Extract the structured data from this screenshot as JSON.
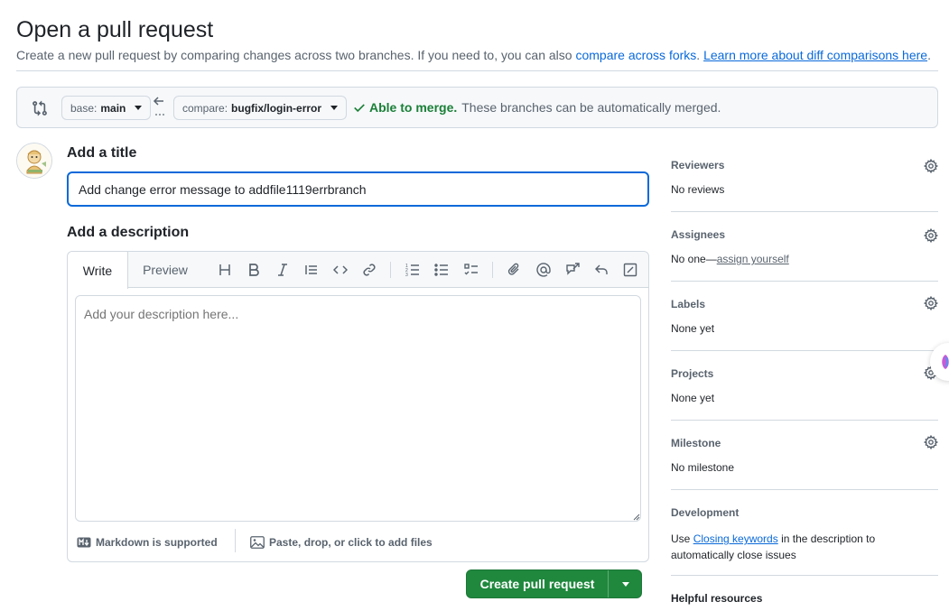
{
  "page": {
    "title": "Open a pull request",
    "subtitle_text": "Create a new pull request by comparing changes across two branches. If you need to, you can also",
    "subtitle_link1": "compare across forks",
    "subtitle_sep": ".",
    "subtitle_link2": "Learn more about diff comparisons here",
    "subtitle_end": "."
  },
  "range": {
    "base_prefix": "base:",
    "base_branch": "main",
    "compare_prefix": "compare:",
    "compare_branch": "bugfix/login-error",
    "status_ok": "Able to merge.",
    "status_text": "These branches can be automatically merged."
  },
  "form": {
    "title_label": "Add a title",
    "title_value": "Add change error message to addfile1119errbranch",
    "desc_label": "Add a description",
    "tab_write": "Write",
    "tab_preview": "Preview",
    "desc_placeholder": "Add your description here...",
    "markdown_note": "Markdown is supported",
    "attach_note": "Paste, drop, or click to add files",
    "submit_label": "Create pull request"
  },
  "sidebar": {
    "reviewers": {
      "heading": "Reviewers",
      "value": "No reviews"
    },
    "assignees": {
      "heading": "Assignees",
      "value_prefix": "No one—",
      "value_link": "assign yourself"
    },
    "labels": {
      "heading": "Labels",
      "value": "None yet"
    },
    "projects": {
      "heading": "Projects",
      "value": "None yet"
    },
    "milestone": {
      "heading": "Milestone",
      "value": "No milestone"
    },
    "development": {
      "heading": "Development",
      "prefix": "Use",
      "link": "Closing keywords",
      "suffix": "in the description to automatically close issues"
    },
    "helpful": {
      "heading": "Helpful resources"
    }
  },
  "colors": {
    "accent": "#0969da",
    "success": "#1a7f37",
    "primary_button": "#1f883d",
    "border": "#d1d9e0",
    "muted": "#59636e"
  }
}
